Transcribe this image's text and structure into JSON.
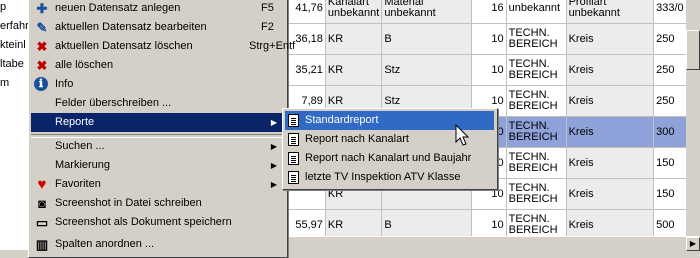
{
  "left_pane": {
    "items": [
      "p",
      "erfahr",
      "kteinl",
      "ltabe",
      "m"
    ]
  },
  "table": {
    "rows": [
      {
        "cells": [
          "41,76",
          "Kanalart unbekannt",
          "Material unbekannt",
          "16",
          "unbekannt",
          "Profilart unbekannt",
          "333/0"
        ],
        "selected": false
      },
      {
        "cells": [
          "36,18",
          "KR",
          "B",
          "10",
          "TECHN. BEREICH",
          "Kreis",
          "250"
        ],
        "selected": false
      },
      {
        "cells": [
          "35,21",
          "KR",
          "Stz",
          "10",
          "TECHN. BEREICH",
          "Kreis",
          "250"
        ],
        "selected": false
      },
      {
        "cells": [
          "7,89",
          "KR",
          "Stz",
          "10",
          "TECHN. BEREICH",
          "Kreis",
          "250"
        ],
        "selected": false
      },
      {
        "cells": [
          "",
          "KR",
          "",
          "10",
          "TECHN. BEREICH",
          "Kreis",
          "300"
        ],
        "selected": true
      },
      {
        "cells": [
          "",
          "KR",
          "",
          "10",
          "TECHN. BEREICH",
          "Kreis",
          "150"
        ],
        "selected": false
      },
      {
        "cells": [
          "",
          "KR",
          "",
          "10",
          "TECHN. BEREICH",
          "Kreis",
          "150"
        ],
        "selected": false
      },
      {
        "cells": [
          "55,97",
          "KR",
          "B",
          "10",
          "TECHN. BEREICH",
          "Kreis",
          "500"
        ],
        "selected": false
      }
    ]
  },
  "context_menu": {
    "items": [
      {
        "label": "neuen Datensatz anlegen",
        "shortcut": "F5",
        "icon": "new-record-icon"
      },
      {
        "label": "aktuellen Datensatz bearbeiten",
        "shortcut": "F2",
        "icon": "edit-record-icon"
      },
      {
        "label": "aktuellen Datensatz löschen",
        "shortcut": "Strg+Entf",
        "icon": "delete-record-icon"
      },
      {
        "label": "alle löschen",
        "shortcut": "",
        "icon": "delete-all-icon"
      },
      {
        "label": "Info",
        "shortcut": "",
        "icon": "info-icon"
      },
      {
        "label": "Felder überschreiben ...",
        "shortcut": "",
        "icon": ""
      },
      {
        "label": "Reporte",
        "shortcut": "",
        "icon": "",
        "submenu": true,
        "highlighted": true
      },
      {
        "label": "Suchen ...",
        "shortcut": "",
        "icon": "",
        "submenu": true
      },
      {
        "label": "Markierung",
        "shortcut": "",
        "icon": "",
        "submenu": true
      },
      {
        "label": "Favoriten",
        "shortcut": "",
        "icon": "heart-icon",
        "submenu": true
      },
      {
        "label": "Screenshot in Datei schreiben",
        "shortcut": "",
        "icon": "camera-icon"
      },
      {
        "label": "Screenshot als Dokument speichern",
        "shortcut": "",
        "icon": "monitor-icon"
      },
      {
        "label": "Spalten anordnen ...",
        "shortcut": "",
        "icon": "columns-icon"
      }
    ]
  },
  "submenu": {
    "items": [
      {
        "label": "Standardreport",
        "highlighted": true
      },
      {
        "label": "Report nach Kanalart"
      },
      {
        "label": "Report nach Kanalart und Baujahr"
      },
      {
        "label": "letzte TV Inspektion ATV Klasse"
      }
    ]
  },
  "colors": {
    "menu_highlight": "#0a246a",
    "submenu_highlight": "#316ac5",
    "selected_row": "#8ea2d9"
  },
  "glyphs": {
    "new": "✚",
    "edit": "✎",
    "delete": "✖",
    "delete_all": "✖",
    "info": "ℹ",
    "arrow": "▶",
    "heart": "♥",
    "camera": "◙",
    "monitor": "▭",
    "columns": "▥",
    "scroll_right": "▶"
  }
}
